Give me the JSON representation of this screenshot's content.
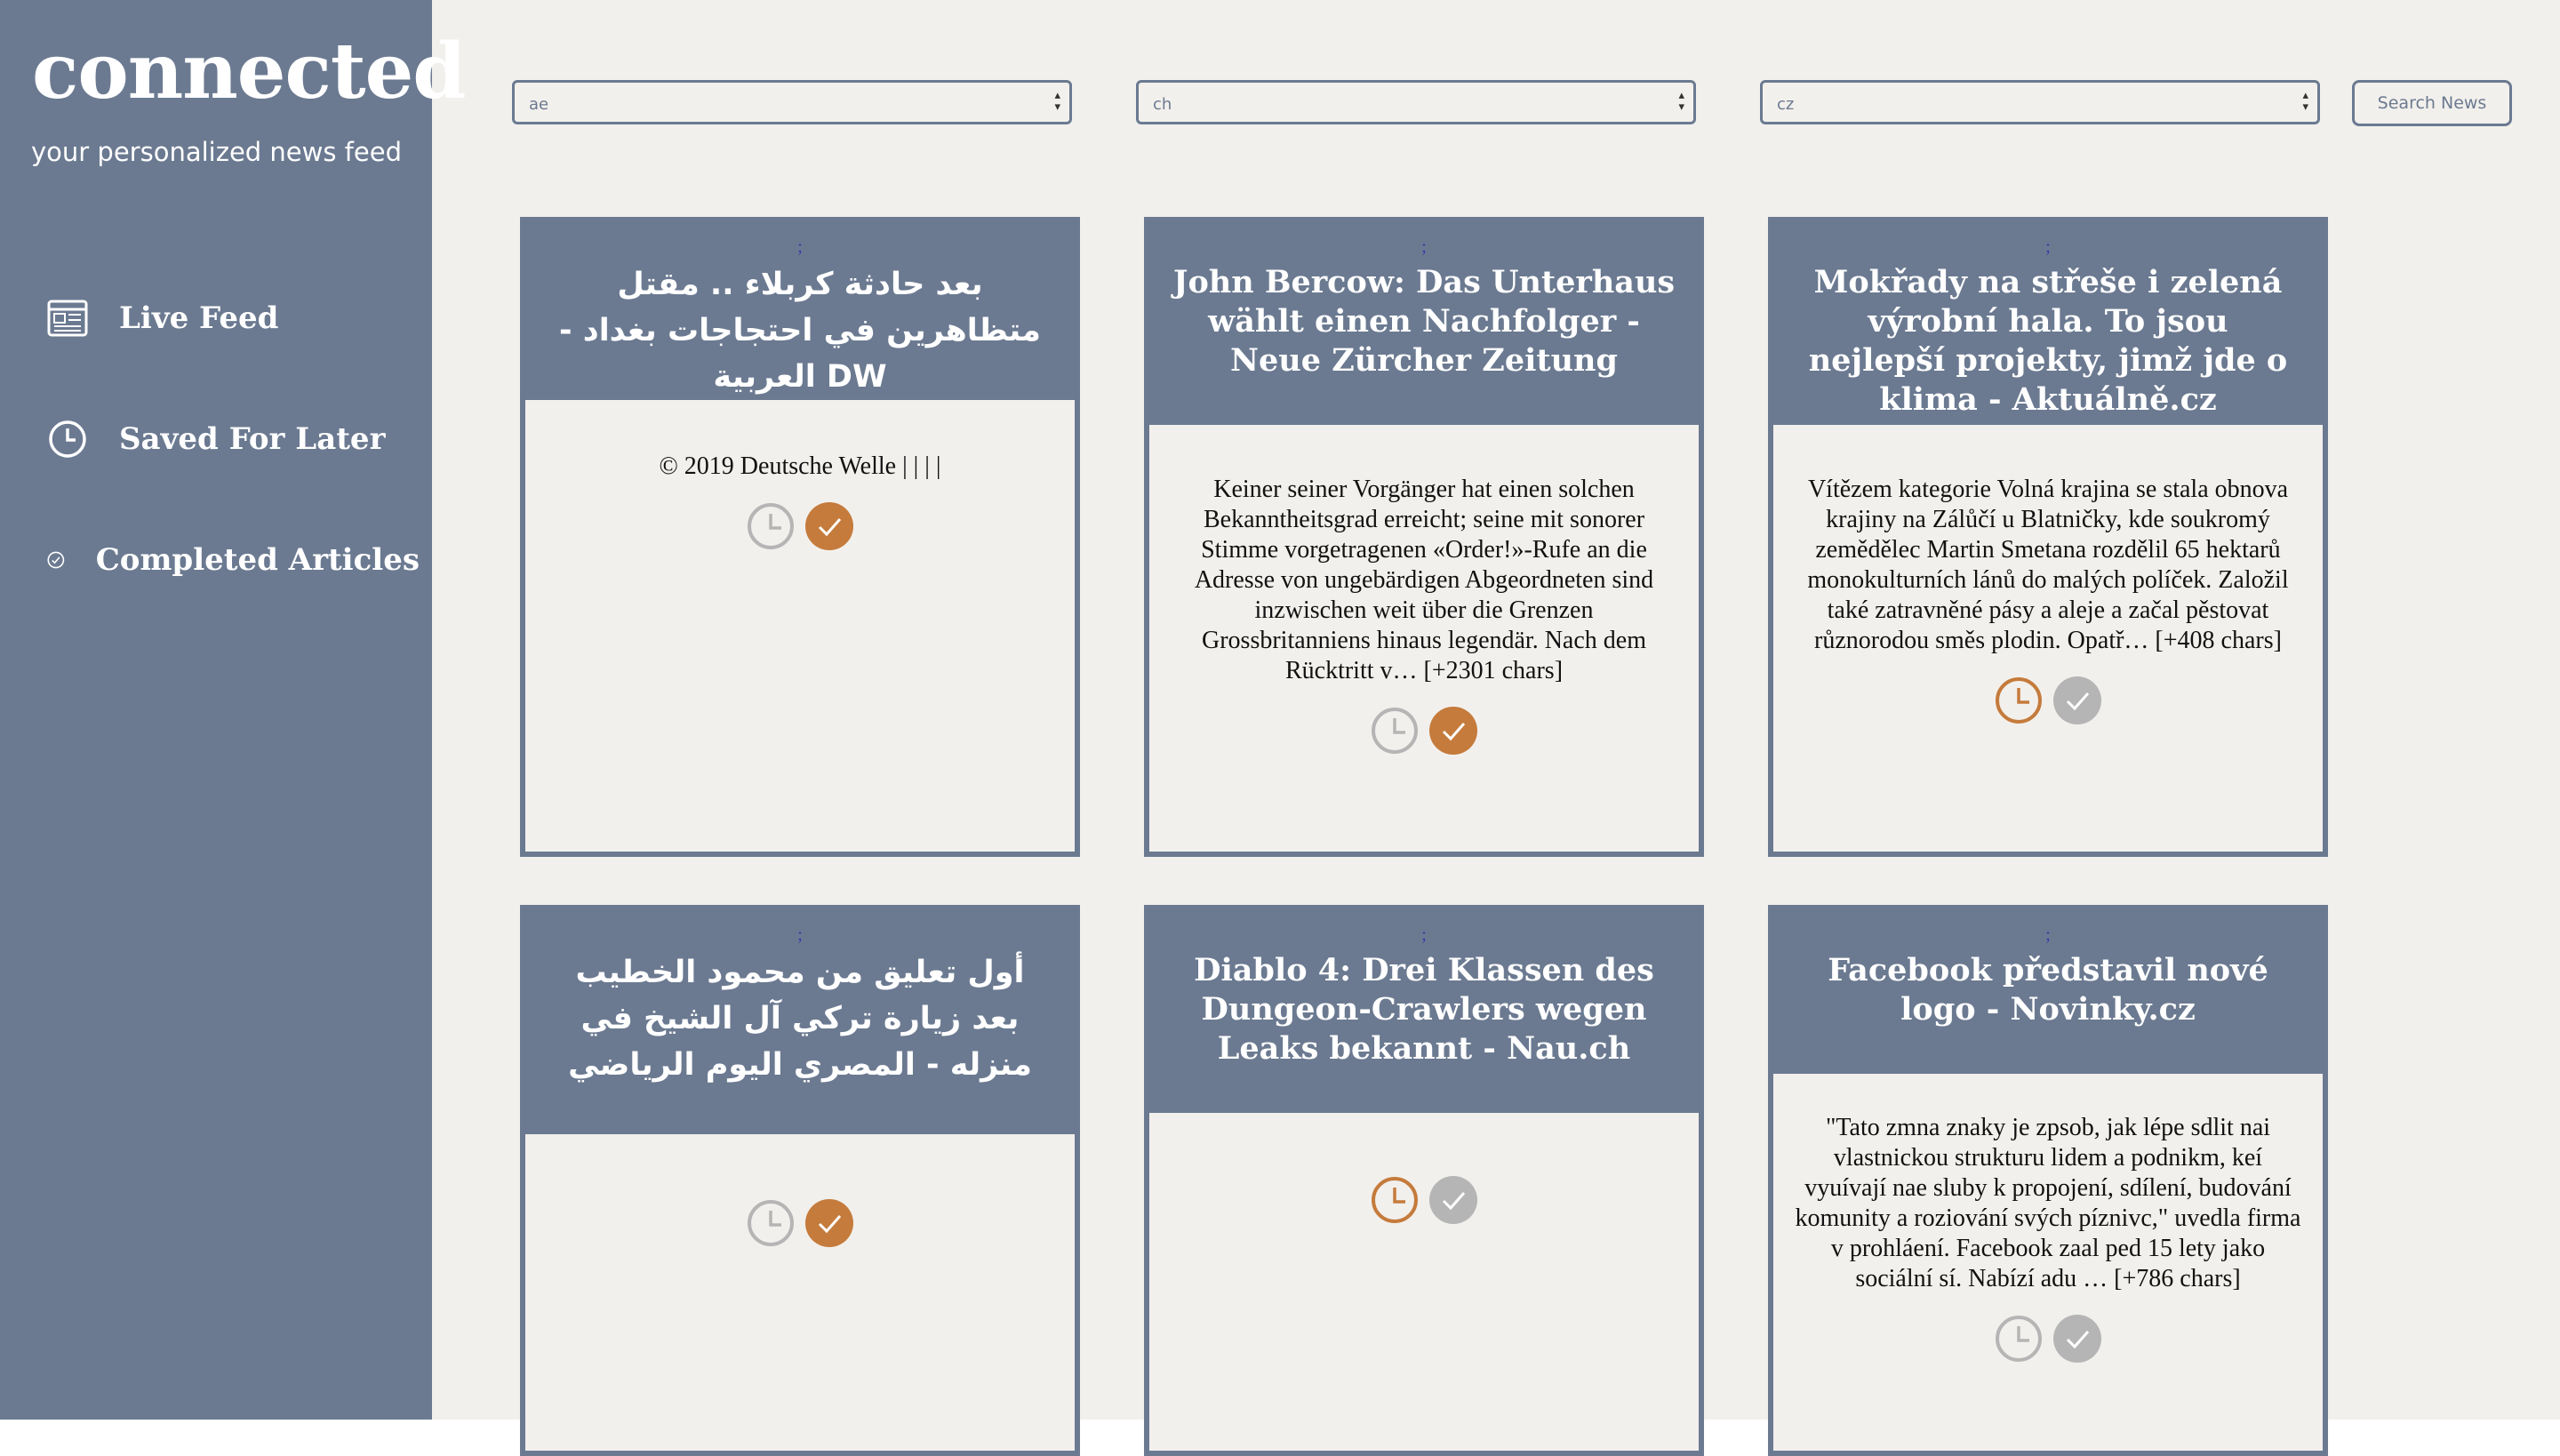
{
  "app": {
    "logo": "connected",
    "tagline": "your personalized news feed"
  },
  "sidebar": {
    "items": [
      {
        "label": "Live Feed",
        "icon": "newspaper-icon"
      },
      {
        "label": "Saved For Later",
        "icon": "clock-icon"
      },
      {
        "label": "Completed Articles",
        "icon": "check-circle-icon"
      }
    ]
  },
  "filters": {
    "country1": "ae",
    "country2": "ch",
    "country3": "cz",
    "search_label": "Search News"
  },
  "articles": [
    {
      "title": "بعد حادثة كربلاء .. مقتل متظاهرين في احتجاجات بغداد - DW العربية",
      "description": "© 2019 Deutsche Welle | | | |",
      "saved": false,
      "completed": true
    },
    {
      "title": "John Bercow: Das Unterhaus wählt einen Nachfolger - Neue Zürcher Zeitung",
      "description": "Keiner seiner Vorgänger hat einen solchen Bekanntheitsgrad erreicht; seine mit sonorer Stimme vorgetragenen «Order!»-Rufe an die Adresse von ungebärdigen Abgeordneten sind inzwischen weit über die Grenzen Grossbritanniens hinaus legendär. Nach dem Rücktritt v… [+2301 chars]",
      "saved": false,
      "completed": true
    },
    {
      "title": "Mokřady na střeše i zelená výrobní hala. To jsou nejlepší projekty, jimž jde o klima - Aktuálně.cz",
      "description": "Vítězem kategorie Volná krajina se stala obnova krajiny na Zálůčí u Blatničky, kde soukromý zemědělec Martin Smetana rozdělil 65 hektarů monokulturních lánů do malých políček. Založil také zatravněné pásy a aleje a začal pěstovat různorodou směs plodin. Opatř… [+408 chars]",
      "saved": true,
      "completed": false
    },
    {
      "title": "أول تعليق من محمود الخطيب بعد زيارة تركي آل الشيخ في منزله - المصري اليوم الرياضي",
      "description": "",
      "saved": false,
      "completed": true
    },
    {
      "title": "Diablo 4: Drei Klassen des Dungeon-Crawlers wegen Leaks bekannt - Nau.ch",
      "description": "",
      "saved": true,
      "completed": false
    },
    {
      "title": "Facebook představil nové logo - Novinky.cz",
      "description": "\"Tato zmna znaky je zpsob, jak lépe sdlit nai vlastnickou strukturu lidem a podnikm, keí vyuívají nae sluby k propojení, sdílení, budování komunity a roziování svých píznivc,\" uvedla firma v prohláení. Facebook zaal ped 15 lety jako sociální sí. Nabízí adu … [+786 chars]",
      "saved": false,
      "completed": false
    }
  ],
  "colors": {
    "sidebar": "#6b7a91",
    "background": "#f2f0ec",
    "active_action": "#c57b3c",
    "inactive_action": "#b5b5b5"
  }
}
